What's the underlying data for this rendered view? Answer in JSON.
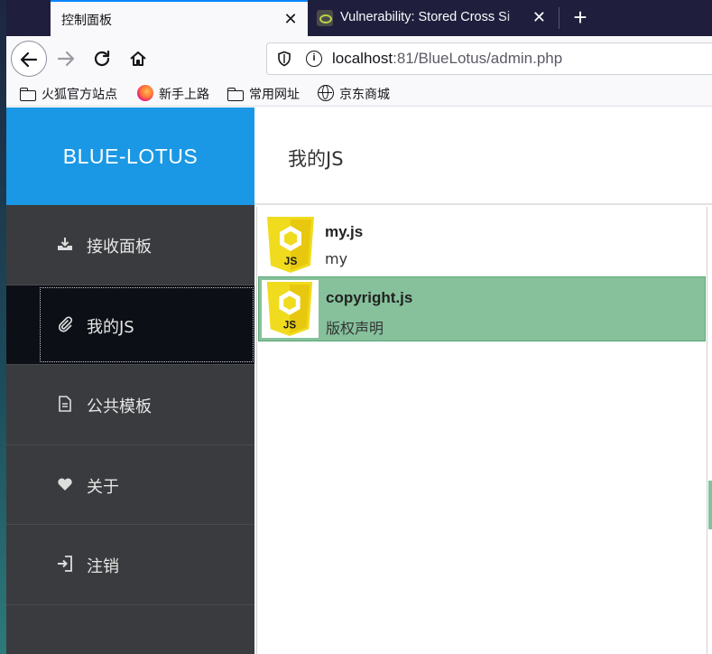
{
  "browser": {
    "tabs": [
      {
        "title": "控制面板",
        "active": true
      },
      {
        "title": "Vulnerability: Stored Cross Si",
        "active": false
      }
    ],
    "url_host": "localhost",
    "url_rest": ":81/BlueLotus/admin.php",
    "bookmarks": [
      {
        "label": "火狐官方站点",
        "icon": "folder-icon"
      },
      {
        "label": "新手上路",
        "icon": "firefox-icon"
      },
      {
        "label": "常用网址",
        "icon": "folder-icon"
      },
      {
        "label": "京东商城",
        "icon": "globe-icon"
      }
    ]
  },
  "app": {
    "brand": "BLUE-LOTUS",
    "page_title": "我的JS",
    "menu": [
      {
        "label": "接收面板",
        "icon": "download-tray-icon",
        "active": false
      },
      {
        "label": "我的JS",
        "icon": "paperclip-icon",
        "active": true
      },
      {
        "label": "公共模板",
        "icon": "document-icon",
        "active": false
      },
      {
        "label": "关于",
        "icon": "heart-icon",
        "active": false
      },
      {
        "label": "注销",
        "icon": "sign-out-icon",
        "active": false
      }
    ],
    "scripts": [
      {
        "name": "my.js",
        "description": "my",
        "selected": false
      },
      {
        "name": "copyright.js",
        "description": "版权声明",
        "selected": true
      }
    ],
    "js_badge": "JS"
  },
  "colors": {
    "brand_blue": "#1a98e5",
    "sidebar_bg": "#3a3b3e",
    "sidebar_active": "#0c1016",
    "selected_row": "#86c19c",
    "js_yellow": "#f0db1e"
  }
}
